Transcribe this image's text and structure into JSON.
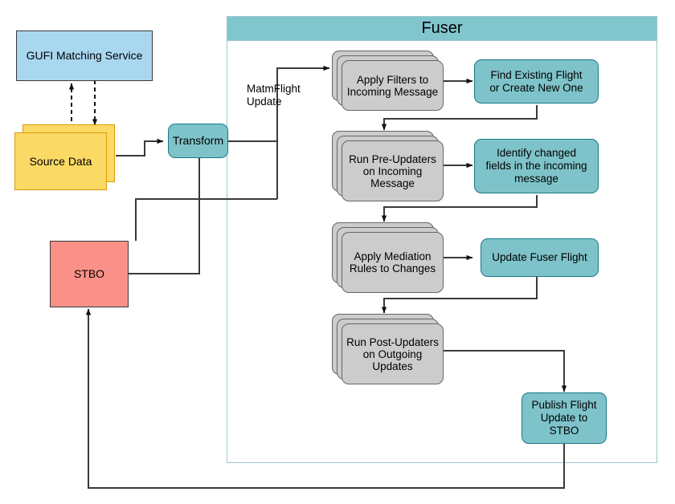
{
  "diagram": {
    "title_visible": false,
    "colors": {
      "teal_fill": "#7ec3c9",
      "teal_border": "#17788c",
      "panel_header": "#81c6cd",
      "panel_border": "#9cc6cc",
      "gray_fill": "#cccccc",
      "gray_border": "#666666",
      "blue_fill": "#a9d7f0",
      "blue_border": "#3a3a3a",
      "yellow_fill": "#fbd965",
      "yellow_border": "#d79b00",
      "red_fill": "#fa9189",
      "red_border": "#3a3a3a",
      "wire": "#3a3a3a"
    }
  },
  "fuser": {
    "header_label": "Fuser"
  },
  "external": {
    "gufi": {
      "label": "GUFI Matching Service"
    },
    "source_data": {
      "label": "Source Data"
    },
    "stbo": {
      "label": "STBO"
    },
    "transform": {
      "label": "Transform"
    }
  },
  "edges": {
    "matmflight_label": "MatmFlight\nUpdate"
  },
  "steps": [
    {
      "id": "apply-filters",
      "kind": "stack",
      "label": "Apply Filters\nto Incoming\nMessage"
    },
    {
      "id": "find-flight",
      "kind": "teal",
      "label": "Find Existing Flight\nor Create New One"
    },
    {
      "id": "run-pre-updaters",
      "kind": "stack",
      "label": "Run\nPre-Updaters\non Incoming\nMessage"
    },
    {
      "id": "identify-changed",
      "kind": "teal",
      "label": "Identify changed\nfields in the incoming\nmessage"
    },
    {
      "id": "apply-mediation",
      "kind": "stack",
      "label": "Apply\nMediation\nRules to\nChanges"
    },
    {
      "id": "update-flight",
      "kind": "teal",
      "label": "Update Fuser Flight"
    },
    {
      "id": "run-post-updaters",
      "kind": "stack",
      "label": "Run\nPost-Updaters\non Outgoing\nUpdates"
    },
    {
      "id": "publish-flight",
      "kind": "teal",
      "label": "Publish Flight\nUpdate to\nSTBO"
    }
  ]
}
